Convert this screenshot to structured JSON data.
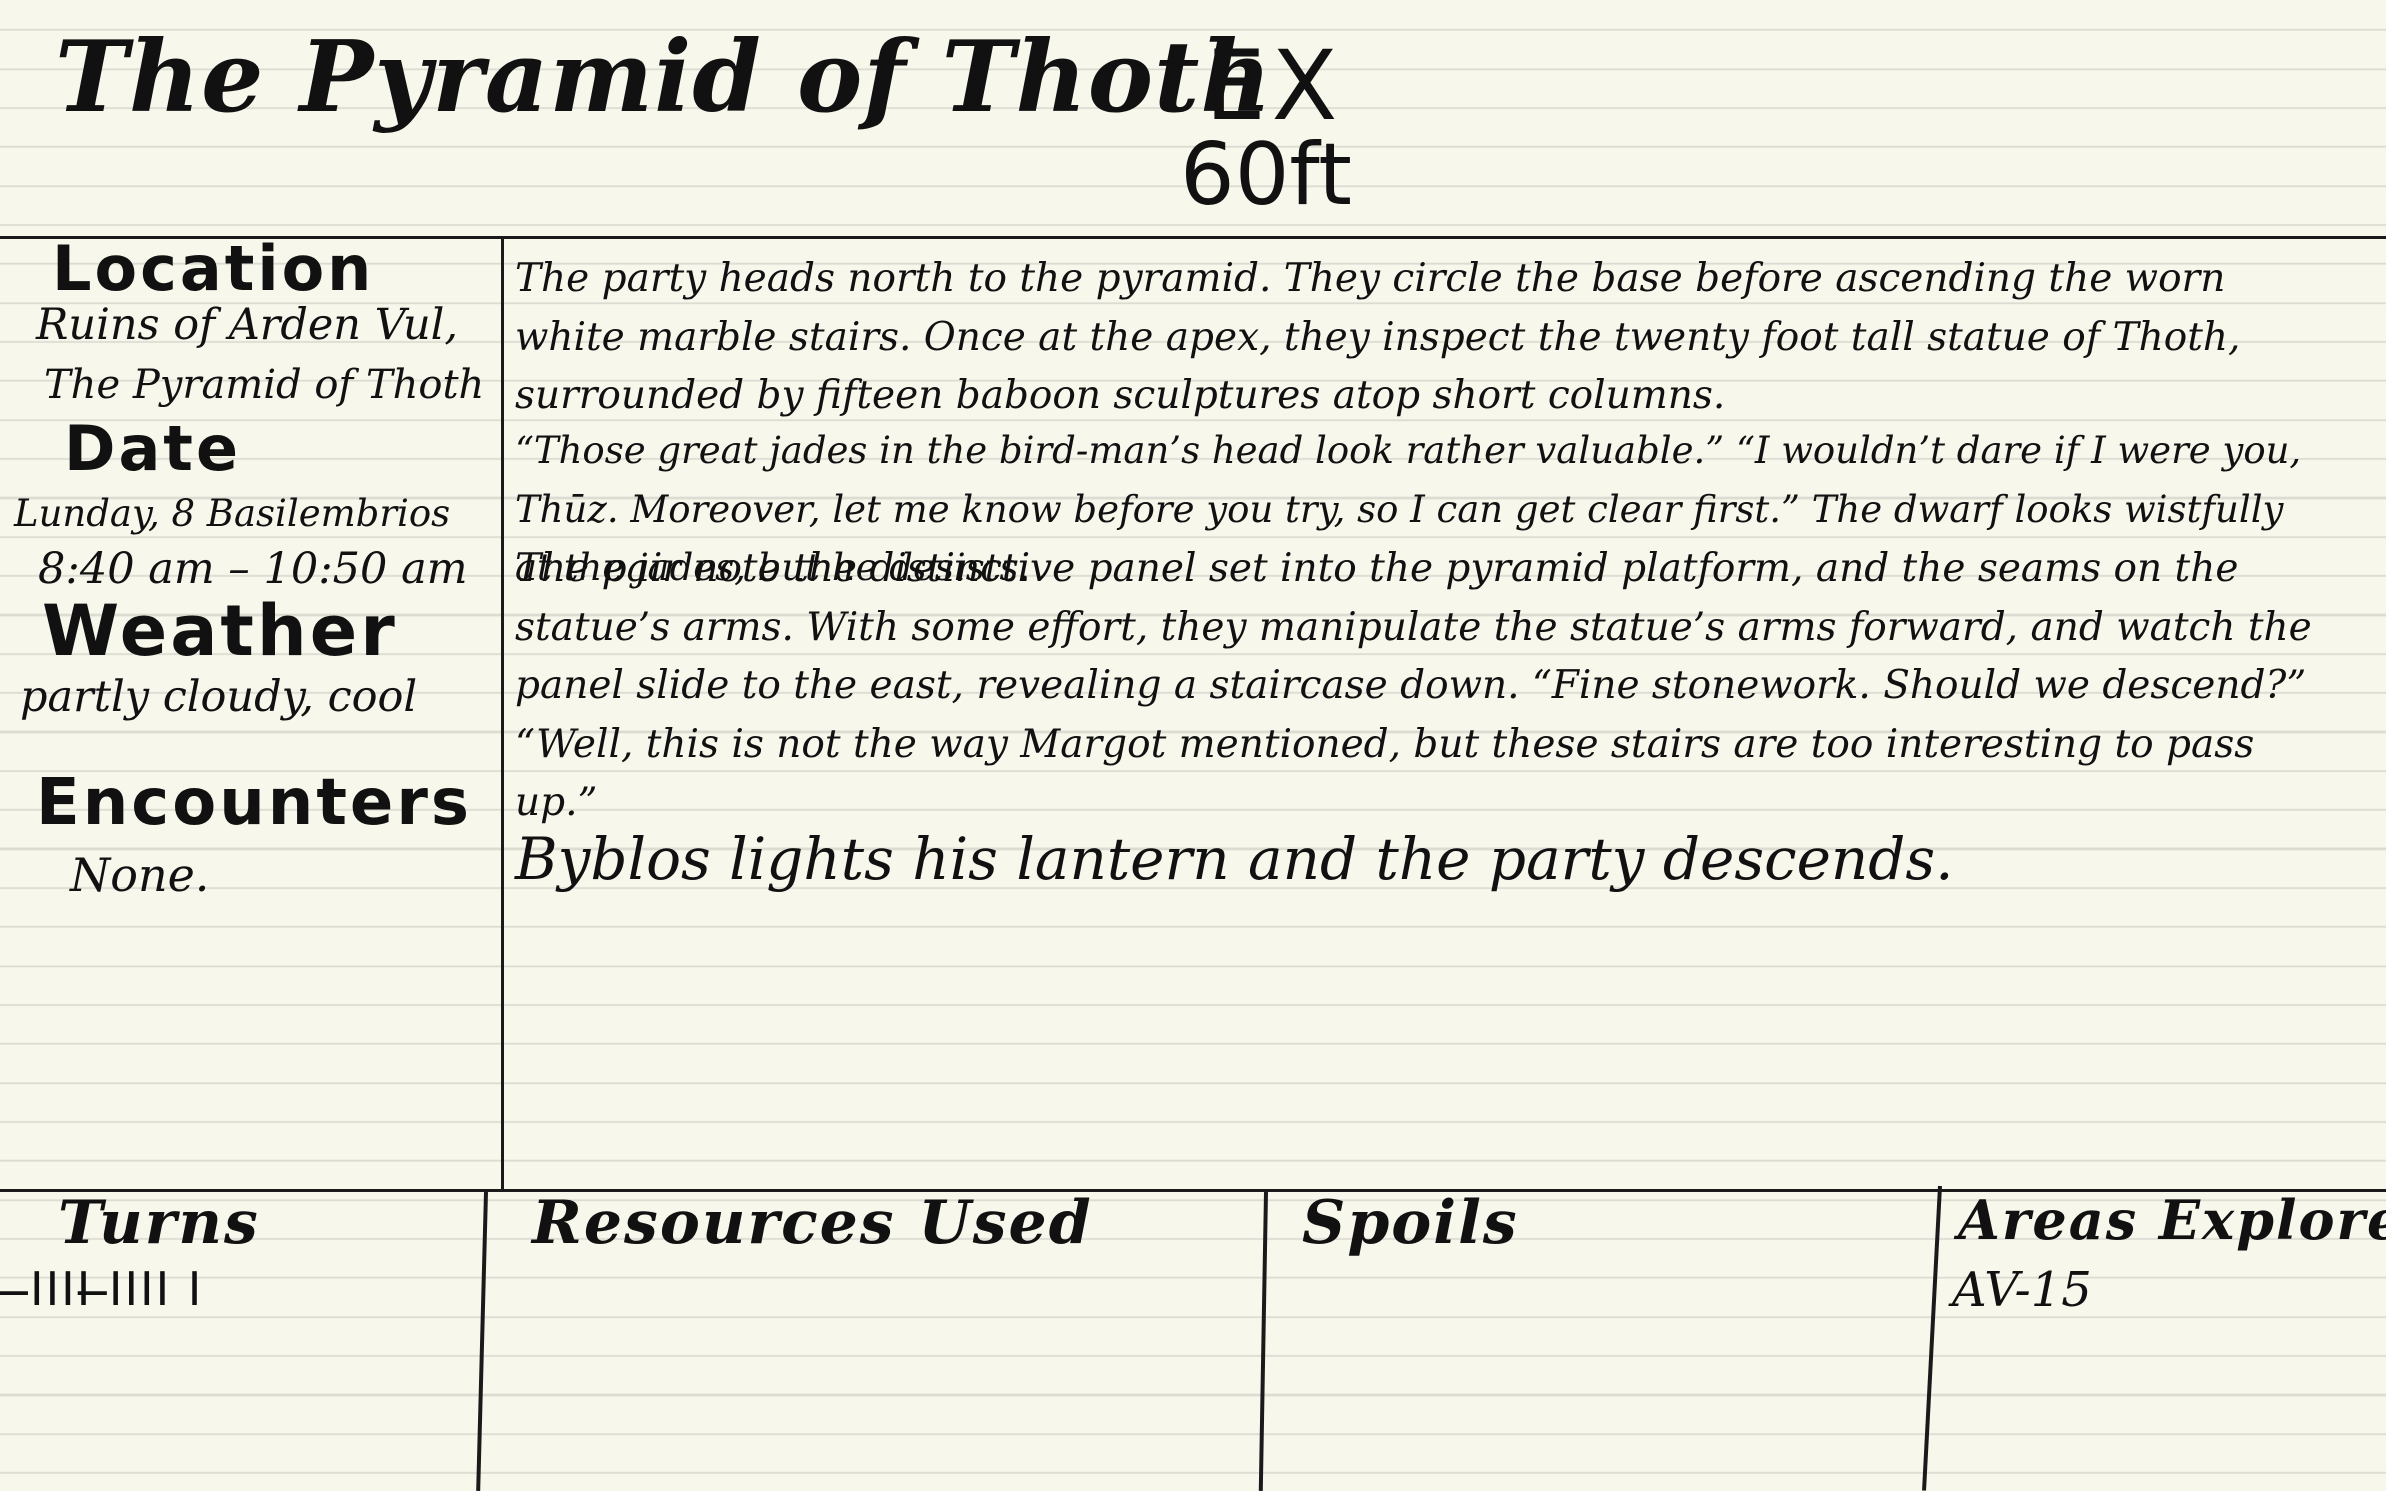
{
  "header": {
    "title": "The Pyramid of Thoth",
    "mode": "EX",
    "speed": "60ft"
  },
  "sidebar": {
    "location_label": "Location",
    "location_line1": "Ruins of Arden Vul,",
    "location_line2": "The Pyramid of Thoth",
    "date_label": "Date",
    "date_value": "Lunday, 8 Basilembrios",
    "time_value": "8:40 am – 10:50 am",
    "weather_label": "Weather",
    "weather_value": "partly cloudy, cool",
    "encounters_label": "Encounters",
    "encounters_value": "None."
  },
  "narrative": {
    "p1": "The party heads north to the pyramid. They circle the base before ascending the worn white marble stairs. Once at the apex, they inspect the twenty foot tall statue of Thoth, surrounded by fifteen baboon sculptures atop short columns.",
    "p2": "“Those great jades in the bird-man’s head look rather valuable.” “I wouldn’t dare if I were you, Thūz. Moreover, let me know before you try, so I can get clear first.” The dwarf looks wistfully at the jades, but he desists.",
    "p3": "The pair note the distinctive panel set into the pyramid platform, and the seams on the statue’s arms. With some effort, they manipulate the statue’s arms forward, and watch the panel slide to the east, revealing a staircase down. “Fine stonework. Should we descend?” “Well, this is not the way Margot mentioned, but these stairs are too interesting to pass up.”",
    "p4": "Byblos lights his lantern and the party descends."
  },
  "footer": {
    "turns_label": "Turns",
    "turns_tally": "̶IIII  ̶IIII  I",
    "resources_label": "Resources Used",
    "spoils_label": "Spoils",
    "areas_label": "Areas Explored",
    "areas_value": "AV-15"
  }
}
